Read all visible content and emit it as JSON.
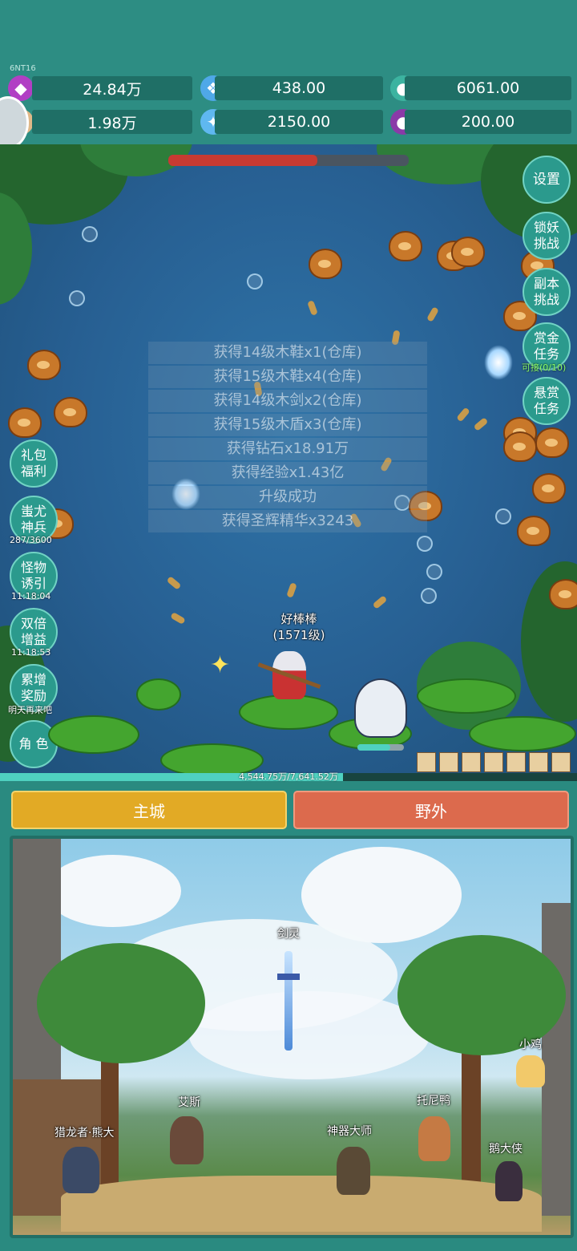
{
  "version": "6NT16",
  "resources": [
    {
      "icon": "purple-gem-icon",
      "value": "24.84万"
    },
    {
      "icon": "blue-crystal-icon",
      "value": "438.00"
    },
    {
      "icon": "teal-orb-icon",
      "value": "6061.00"
    },
    {
      "icon": "horn-icon",
      "value": "1.98万"
    },
    {
      "icon": "ice-crystal-icon",
      "value": "2150.00"
    },
    {
      "icon": "purple-fruit-icon",
      "value": "200.00"
    }
  ],
  "log": [
    "获得14级木鞋x1(仓库)",
    "获得15级木鞋x4(仓库)",
    "获得14级木剑x2(仓库)",
    "获得15级木盾x3(仓库)",
    "获得钻石x18.91万",
    "获得经验x1.43亿",
    "升级成功",
    "获得圣辉精华x3243"
  ],
  "right_buttons": {
    "settings": "设置",
    "lock_demon": [
      "锁妖",
      "挑战"
    ],
    "dungeon": [
      "副本",
      "挑战"
    ],
    "bounty": [
      "赏金",
      "任务"
    ],
    "bounty_status": "可接(0/10)",
    "reward_task": [
      "悬赏",
      "任务"
    ]
  },
  "left_buttons": {
    "gift": [
      "礼包",
      "福利"
    ],
    "chiyou": [
      "蚩尤",
      "神兵"
    ],
    "chiyou_count": "287/3600",
    "lure": [
      "怪物",
      "诱引"
    ],
    "lure_time": "11:18:04",
    "double": [
      "双倍",
      "增益"
    ],
    "double_time": "11:18:53",
    "accum": [
      "累增",
      "奖励"
    ],
    "accum_note": "明天再来吧",
    "role": [
      "角",
      "色"
    ]
  },
  "hero": {
    "name": "好棒棒",
    "level": "(1571级)",
    "hp_fraction": 0.62,
    "pet_hp_fraction": 0.7
  },
  "exp": {
    "text": "4,544.75万/7,641.52万",
    "fraction": 0.595
  },
  "tabs": {
    "main_city": "主城",
    "wild": "野外"
  },
  "town_npcs": {
    "sword_spirit": "剑灵",
    "chicken": "小鸡",
    "ais": "艾斯",
    "tony_duck": "托尼鸭",
    "hunter_bear": "猎龙者·熊大",
    "artifact_master": "神器大师",
    "goose_hero": "鹅大侠"
  },
  "colors": {
    "tab_main": "#e2aa25",
    "tab_wild": "#dc6a4d",
    "hp": "#c73a32",
    "panel": "#2d8d83"
  }
}
